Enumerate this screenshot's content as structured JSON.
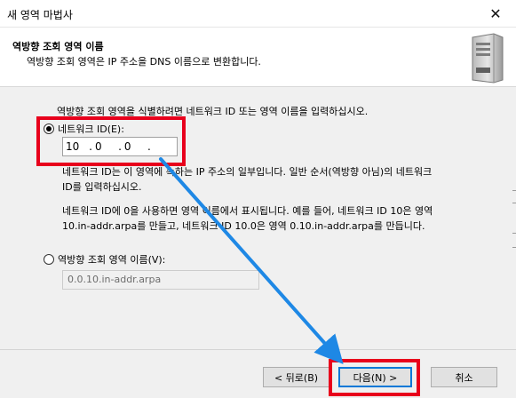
{
  "window": {
    "title": "새 영역 마법사"
  },
  "header": {
    "title": "역방향 조회 영역 이름",
    "subtitle": "역방향 조회 영역은 IP 주소을 DNS 이름으로 변환합니다."
  },
  "main": {
    "intro": "역방향 조회 영역을 식별하려면 네트워크 ID 또는 영역 이름을 입력하십시오.",
    "network_id_option": {
      "label": "네트워크 ID(E):",
      "selected": true
    },
    "network_id_octets": [
      "10",
      "0",
      "0",
      ""
    ],
    "desc1_line1": "네트워크 ID는 이 영역에 속하는 IP 주소의 일부입니다. 일반 순서(역방향 아님)의 네트워크",
    "desc1_line2": "ID를 입력하십시오.",
    "desc2_line1": "네트워크 ID에 0을 사용하면 영역 이름에서 표시됩니다. 예를 들어, 네트워크 ID 10은 영역",
    "desc2_line2": "10.in-addr.arpa를 만들고, 네트워크 ID 10.0은 영역 0.10.in-addr.arpa를 만듭니다.",
    "zone_name_option": {
      "label": "역방향 조회 영역 이름(V):",
      "selected": false
    },
    "zone_name_value": "0.0.10.in-addr.arpa"
  },
  "footer": {
    "back_label": "< 뒤로(B)",
    "next_label": "다음(N) >",
    "cancel_label": "취소"
  },
  "colors": {
    "highlight": "#e8001c",
    "arrow": "#1e88e5"
  },
  "icons": {
    "close": "close-icon",
    "server": "server-icon"
  }
}
